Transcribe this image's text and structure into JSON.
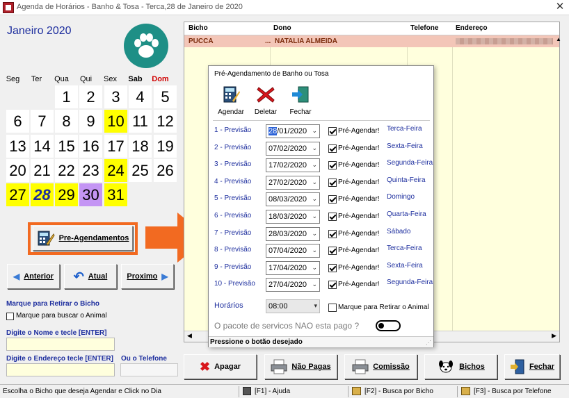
{
  "window": {
    "title": "Agenda de Horários - Banho & Tosa - Terca,28 de Janeiro de 2020",
    "close": "✕"
  },
  "calendar": {
    "month_title": "Janeiro 2020",
    "weekdays": [
      "Seg",
      "Ter",
      "Qua",
      "Qui",
      "Sex",
      "Sab",
      "Dom"
    ],
    "days": [
      {
        "n": "1",
        "row": 0,
        "col": 2,
        "hl": ""
      },
      {
        "n": "2",
        "row": 0,
        "col": 3,
        "hl": ""
      },
      {
        "n": "3",
        "row": 0,
        "col": 4,
        "hl": ""
      },
      {
        "n": "4",
        "row": 0,
        "col": 5,
        "hl": ""
      },
      {
        "n": "5",
        "row": 0,
        "col": 6,
        "hl": ""
      },
      {
        "n": "6",
        "row": 1,
        "col": 0,
        "hl": ""
      },
      {
        "n": "7",
        "row": 1,
        "col": 1,
        "hl": ""
      },
      {
        "n": "8",
        "row": 1,
        "col": 2,
        "hl": ""
      },
      {
        "n": "9",
        "row": 1,
        "col": 3,
        "hl": ""
      },
      {
        "n": "10",
        "row": 1,
        "col": 4,
        "hl": "yellow"
      },
      {
        "n": "11",
        "row": 1,
        "col": 5,
        "hl": ""
      },
      {
        "n": "12",
        "row": 1,
        "col": 6,
        "hl": ""
      },
      {
        "n": "13",
        "row": 2,
        "col": 0,
        "hl": ""
      },
      {
        "n": "14",
        "row": 2,
        "col": 1,
        "hl": ""
      },
      {
        "n": "15",
        "row": 2,
        "col": 2,
        "hl": ""
      },
      {
        "n": "16",
        "row": 2,
        "col": 3,
        "hl": ""
      },
      {
        "n": "17",
        "row": 2,
        "col": 4,
        "hl": ""
      },
      {
        "n": "18",
        "row": 2,
        "col": 5,
        "hl": ""
      },
      {
        "n": "19",
        "row": 2,
        "col": 6,
        "hl": ""
      },
      {
        "n": "20",
        "row": 3,
        "col": 0,
        "hl": ""
      },
      {
        "n": "21",
        "row": 3,
        "col": 1,
        "hl": ""
      },
      {
        "n": "22",
        "row": 3,
        "col": 2,
        "hl": ""
      },
      {
        "n": "23",
        "row": 3,
        "col": 3,
        "hl": ""
      },
      {
        "n": "24",
        "row": 3,
        "col": 4,
        "hl": "yellow"
      },
      {
        "n": "25",
        "row": 3,
        "col": 5,
        "hl": ""
      },
      {
        "n": "26",
        "row": 3,
        "col": 6,
        "hl": ""
      },
      {
        "n": "27",
        "row": 4,
        "col": 0,
        "hl": "yellow"
      },
      {
        "n": "28",
        "row": 4,
        "col": 1,
        "hl": "yellow today"
      },
      {
        "n": "29",
        "row": 4,
        "col": 2,
        "hl": "yellow"
      },
      {
        "n": "30",
        "row": 4,
        "col": 3,
        "hl": "purple"
      },
      {
        "n": "31",
        "row": 4,
        "col": 4,
        "hl": "yellow"
      }
    ]
  },
  "pre_agendamentos_label": "Pre-Agendamentos",
  "nav": {
    "anterior": "Anterior",
    "atual": "Atual",
    "proximo": "Proximo"
  },
  "left_form": {
    "retirar_label": "Marque para Retirar o Bicho",
    "buscar_check": "Marque para buscar o Animal",
    "nome_label": "Digite o Nome e tecle [ENTER]",
    "endereco_label": "Digite o Endereço tecle [ENTER]",
    "telefone_label": "Ou o Telefone"
  },
  "grid": {
    "columns": [
      "Bicho",
      "Dono",
      "Telefone",
      "Endereço"
    ],
    "rows": [
      {
        "bicho": "PUCCA",
        "ellipsis": "...",
        "dono": "NATALIA ALMEIDA"
      }
    ]
  },
  "modal": {
    "title": "Pré-Agendamento de Banho ou Tosa",
    "toolbar": {
      "agendar": "Agendar",
      "deletar": "Deletar",
      "fechar": "Fechar"
    },
    "check_label": "Pré-Agendar!",
    "rows": [
      {
        "label": "1 - Previsão",
        "date": "28/01/2020",
        "day": "Terca-Feira"
      },
      {
        "label": "2 - Previsão",
        "date": "07/02/2020",
        "day": "Sexta-Feira"
      },
      {
        "label": "3 - Previsão",
        "date": "17/02/2020",
        "day": "Segunda-Feira"
      },
      {
        "label": "4 - Previsão",
        "date": "27/02/2020",
        "day": "Quinta-Feira"
      },
      {
        "label": "5 - Previsão",
        "date": "08/03/2020",
        "day": "Domingo"
      },
      {
        "label": "6 - Previsão",
        "date": "18/03/2020",
        "day": "Quarta-Feira"
      },
      {
        "label": "7 - Previsão",
        "date": "28/03/2020",
        "day": "Sábado"
      },
      {
        "label": "8 - Previsão",
        "date": "07/04/2020",
        "day": "Terca-Feira"
      },
      {
        "label": "9 - Previsão",
        "date": "17/04/2020",
        "day": "Sexta-Feira"
      },
      {
        "label": "10 - Previsão",
        "date": "27/04/2020",
        "day": "Segunda-Feira"
      }
    ],
    "horarios_label": "Horários",
    "horario_value": "08:00",
    "retirar_animal": "Marque para Retirar o Animal",
    "pacote_text": "O pacote de servicos NAO esta pago ?",
    "status": "Pressione o botão desejado"
  },
  "bottom_buttons": {
    "apagar": "Apagar",
    "nao_pagas": "Não Pagas",
    "comissao": "Comissão",
    "bichos": "Bichos",
    "fechar": "Fechar"
  },
  "statusbar": {
    "hint": "Escolha o Bicho que deseja Agendar e Click no Dia",
    "ajuda": "[F1] - Ajuda",
    "busca_bicho": "[F2] - Busca por Bicho",
    "busca_telefone": "[F3] - Busca por Telefone"
  },
  "colors": {
    "accent_blue": "#1d2e9e",
    "highlight_yellow": "#ffff00",
    "highlight_purple": "#c495f4",
    "callout_orange": "#f26a21",
    "grid_bg": "#ffffdd",
    "selected_row": "#f3c6b8"
  }
}
